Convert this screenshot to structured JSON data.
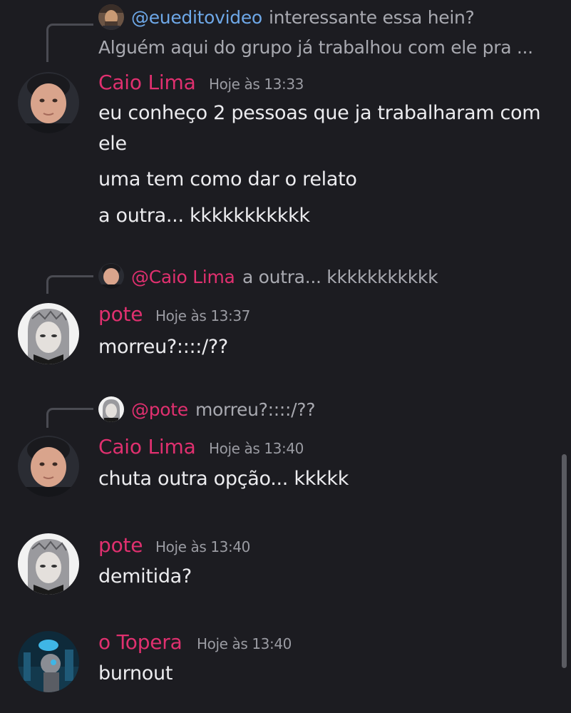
{
  "messages": [
    {
      "reply": {
        "mention": "@eueditovideo",
        "line1": "interessante essa hein?",
        "line2": "Alguém aqui do grupo já trabalhou com ele pra ..."
      },
      "author": "Caio Lima",
      "time": "Hoje às 13:33",
      "lines": [
        "eu conheço 2 pessoas que ja trabalharam com",
        "ele",
        "uma tem como dar o relato",
        "a outra... kkkkkkkkkkk"
      ]
    },
    {
      "reply": {
        "mention": "@Caio Lima",
        "text": "a outra... kkkkkkkkkkk"
      },
      "author": "pote",
      "time": "Hoje às 13:37",
      "lines": [
        "morreu?::::/??"
      ]
    },
    {
      "reply": {
        "mention": "@pote",
        "text": "morreu?::::/??"
      },
      "author": "Caio Lima",
      "time": "Hoje às 13:40",
      "lines": [
        "chuta outra opção... kkkkk"
      ]
    },
    {
      "author": "pote",
      "time": "Hoje às 13:40",
      "lines": [
        "demitida?"
      ]
    },
    {
      "author": "o Topera",
      "time": "Hoje às 13:40",
      "lines": [
        "burnout"
      ]
    }
  ],
  "colors": {
    "background": "#1c1c21",
    "username": "#e0306f",
    "mention_blue": "#6ea8e8",
    "mention_pink": "#e0306f",
    "text": "#ececef",
    "muted": "#a8a9b0"
  }
}
